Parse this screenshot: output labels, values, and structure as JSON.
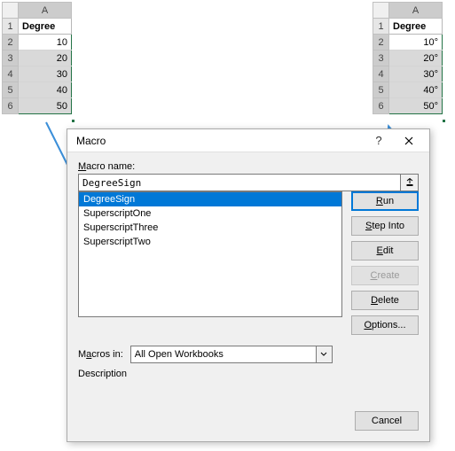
{
  "sheet_left": {
    "col_label": "A",
    "rows": [
      "1",
      "2",
      "3",
      "4",
      "5",
      "6"
    ],
    "header": "Degree",
    "values": [
      "10",
      "20",
      "30",
      "40",
      "50"
    ]
  },
  "sheet_right": {
    "col_label": "A",
    "rows": [
      "1",
      "2",
      "3",
      "4",
      "5",
      "6"
    ],
    "header": "Degree",
    "values": [
      "10°",
      "20°",
      "30°",
      "40°",
      "50°"
    ]
  },
  "dialog": {
    "title": "Macro",
    "help_glyph": "?",
    "name_label": "Macro name:",
    "name_value": "DegreeSign",
    "list_items": [
      "DegreeSign",
      "SuperscriptOne",
      "SuperscriptThree",
      "SuperscriptTwo"
    ],
    "selected_index": 0,
    "buttons": {
      "run": "Run",
      "step_into": "Step Into",
      "edit": "Edit",
      "create": "Create",
      "delete": "Delete",
      "options": "Options..."
    },
    "macros_in_label": "Macros in:",
    "macros_in_value": "All Open Workbooks",
    "description_label": "Description",
    "cancel": "Cancel"
  }
}
